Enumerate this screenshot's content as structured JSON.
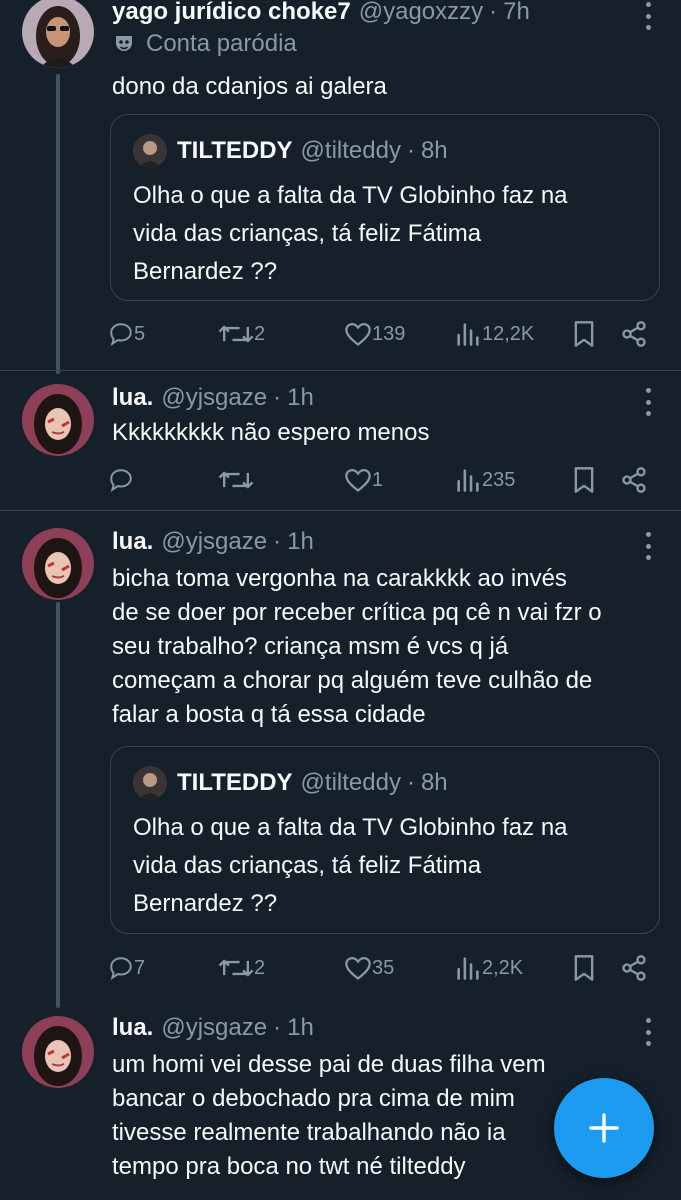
{
  "tweets": [
    {
      "name": "yago jurídico choke7",
      "handle": "@yagoxzzy",
      "time": "7h",
      "parody_label": "Conta paródia",
      "text": "dono da cdanjos ai galera",
      "quote": {
        "name": "TILTEDDY",
        "handle": "@tilteddy",
        "time": "8h",
        "lines": [
          "Olha o que a falta da TV Globinho faz na",
          "vida das crianças, tá feliz Fátima",
          "Bernardez ??"
        ]
      },
      "replies": "5",
      "retweets": "2",
      "likes": "139",
      "views": "12,2K"
    },
    {
      "name": "lua.",
      "handle": "@yjsgaze",
      "time": "1h",
      "text": "Kkkkkkkkk não espero menos",
      "replies": "",
      "retweets": "",
      "likes": "1",
      "views": "235"
    },
    {
      "name": "lua.",
      "handle": "@yjsgaze",
      "time": "1h",
      "lines": [
        "bicha toma vergonha na carakkkk ao invés",
        "de se doer por receber crítica pq cê n vai fzr o",
        "seu trabalho? criança msm é vcs q já",
        "começam a chorar pq alguém teve culhão de",
        "falar a bosta q tá essa cidade"
      ],
      "quote": {
        "name": "TILTEDDY",
        "handle": "@tilteddy",
        "time": "8h",
        "lines": [
          "Olha o que a falta da TV Globinho faz na",
          "vida das crianças, tá feliz Fátima",
          "Bernardez ??"
        ]
      },
      "replies": "7",
      "retweets": "2",
      "likes": "35",
      "views": "2,2K"
    },
    {
      "name": "lua.",
      "handle": "@yjsgaze",
      "time": "1h",
      "lines": [
        "um homi vei desse pai de duas filha vem",
        "bancar o debochado pra cima de mim",
        "tivesse realmente trabalhando não ia",
        "tempo pra boca no twt né tilteddy"
      ]
    }
  ],
  "icons": {
    "reply": "reply-icon",
    "retweet": "retweet-icon",
    "like": "heart-icon",
    "views": "views-icon",
    "bookmark": "bookmark-icon",
    "share": "share-icon",
    "compose": "plus-icon",
    "parody": "parody-mask-icon"
  },
  "colors": {
    "background": "#15202b",
    "accent": "#1d9bf0",
    "secondary_text": "#8b98a5",
    "border": "#38444d"
  }
}
